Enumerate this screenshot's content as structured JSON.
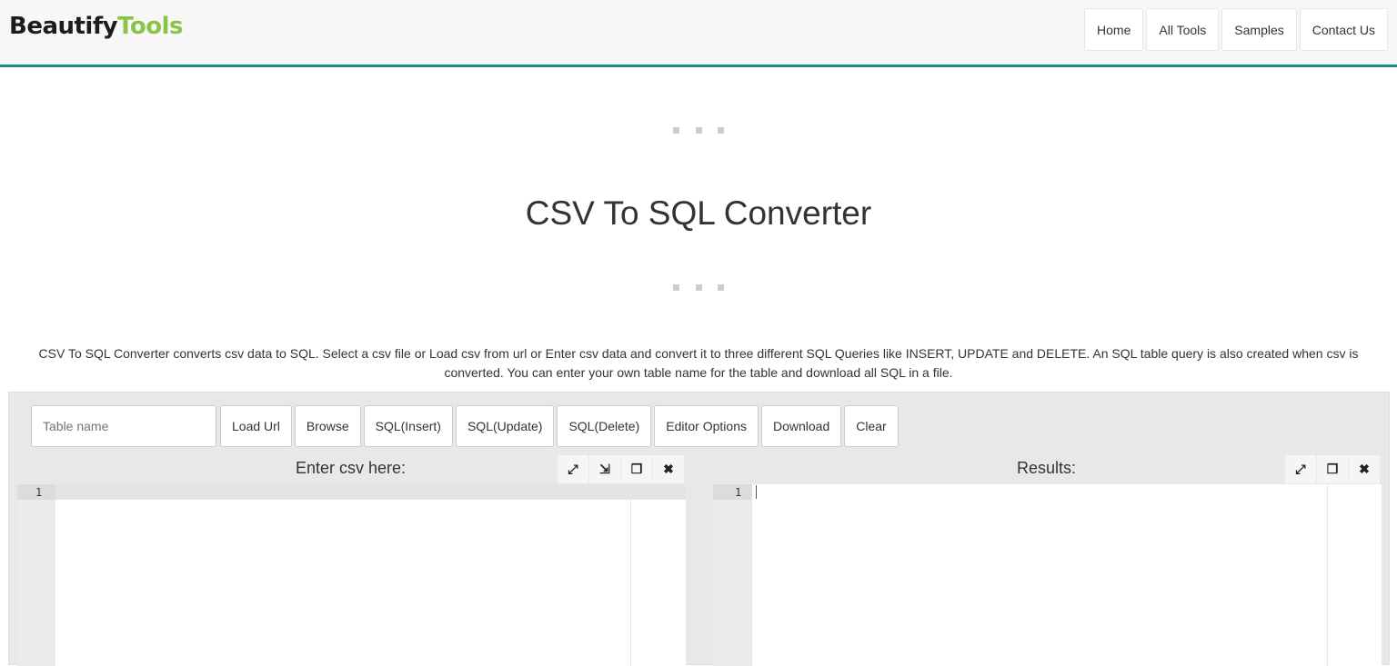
{
  "logo": {
    "part1": "Beautify",
    "part2": "Tools"
  },
  "nav": [
    "Home",
    "All Tools",
    "Samples",
    "Contact Us"
  ],
  "page_title": "CSV To SQL Converter",
  "description": "CSV To SQL Converter converts csv data to SQL. Select a csv file or Load csv from url or Enter csv data and convert it to three different SQL Queries like INSERT, UPDATE and DELETE. An SQL table query is also created when csv is converted. You can enter your own table name for the table and download all SQL in a file.",
  "toolbar": {
    "table_name_placeholder": "Table name",
    "buttons": [
      "Load Url",
      "Browse",
      "SQL(Insert)",
      "SQL(Update)",
      "SQL(Delete)",
      "Editor Options",
      "Download",
      "Clear"
    ]
  },
  "input_editor": {
    "title": "Enter csv here:",
    "line_number": "1",
    "icons": [
      "expand-icon",
      "beautify-icon",
      "copy-icon",
      "close-icon"
    ]
  },
  "output_editor": {
    "title": "Results:",
    "line_number": "1",
    "icons": [
      "expand-icon",
      "copy-icon",
      "close-icon"
    ]
  },
  "colors": {
    "accent": "#1a8a83",
    "logo_green": "#8bc34a"
  }
}
